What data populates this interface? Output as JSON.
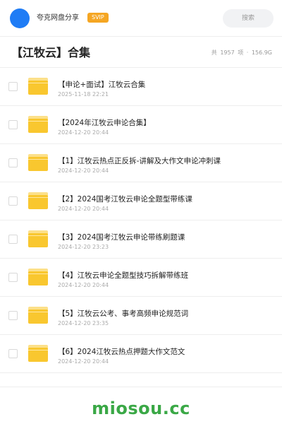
{
  "header": {
    "app_name": "夸克网盘分享",
    "badge": "SVIP",
    "search_label": "搜索",
    "avatar_color": "#1f7cf5"
  },
  "title": {
    "text": "【江牧云】合集",
    "meta_prefix": "共",
    "count": "1957",
    "count_unit": "项",
    "separator": "·",
    "size": "156.9G"
  },
  "files": [
    {
      "name": "【申论+面试】江牧云合集",
      "date": "2025-11-18 22:21",
      "icon": "folder-icon"
    },
    {
      "name": "【2024年江牧云申论合集】",
      "date": "2024-12-20 20:44",
      "icon": "folder-icon"
    },
    {
      "name": "【1】江牧云热点正反拆-讲解及大作文申论冲刺课",
      "date": "2024-12-20 20:44",
      "icon": "folder-icon"
    },
    {
      "name": "【2】2024国考江牧云申论全题型带练课",
      "date": "2024-12-20 20:44",
      "icon": "folder-icon"
    },
    {
      "name": "【3】2024国考江牧云申论带练刷题课",
      "date": "2024-12-20 23:23",
      "icon": "folder-icon"
    },
    {
      "name": "【4】江牧云申论全题型技巧拆解带练班",
      "date": "2024-12-20 20:44",
      "icon": "folder-icon"
    },
    {
      "name": "【5】江牧云公考、事考高频申论规范词",
      "date": "2024-12-20 23:35",
      "icon": "folder-icon"
    },
    {
      "name": "【6】2024江牧云热点押题大作文范文",
      "date": "2024-12-20 20:44",
      "icon": "folder-icon"
    }
  ],
  "watermark": "miosou.cc",
  "colors": {
    "accent": "#1f7cf5",
    "svip": "#f5a623",
    "folder": "#f9c72f",
    "watermark": "#3aa846"
  }
}
